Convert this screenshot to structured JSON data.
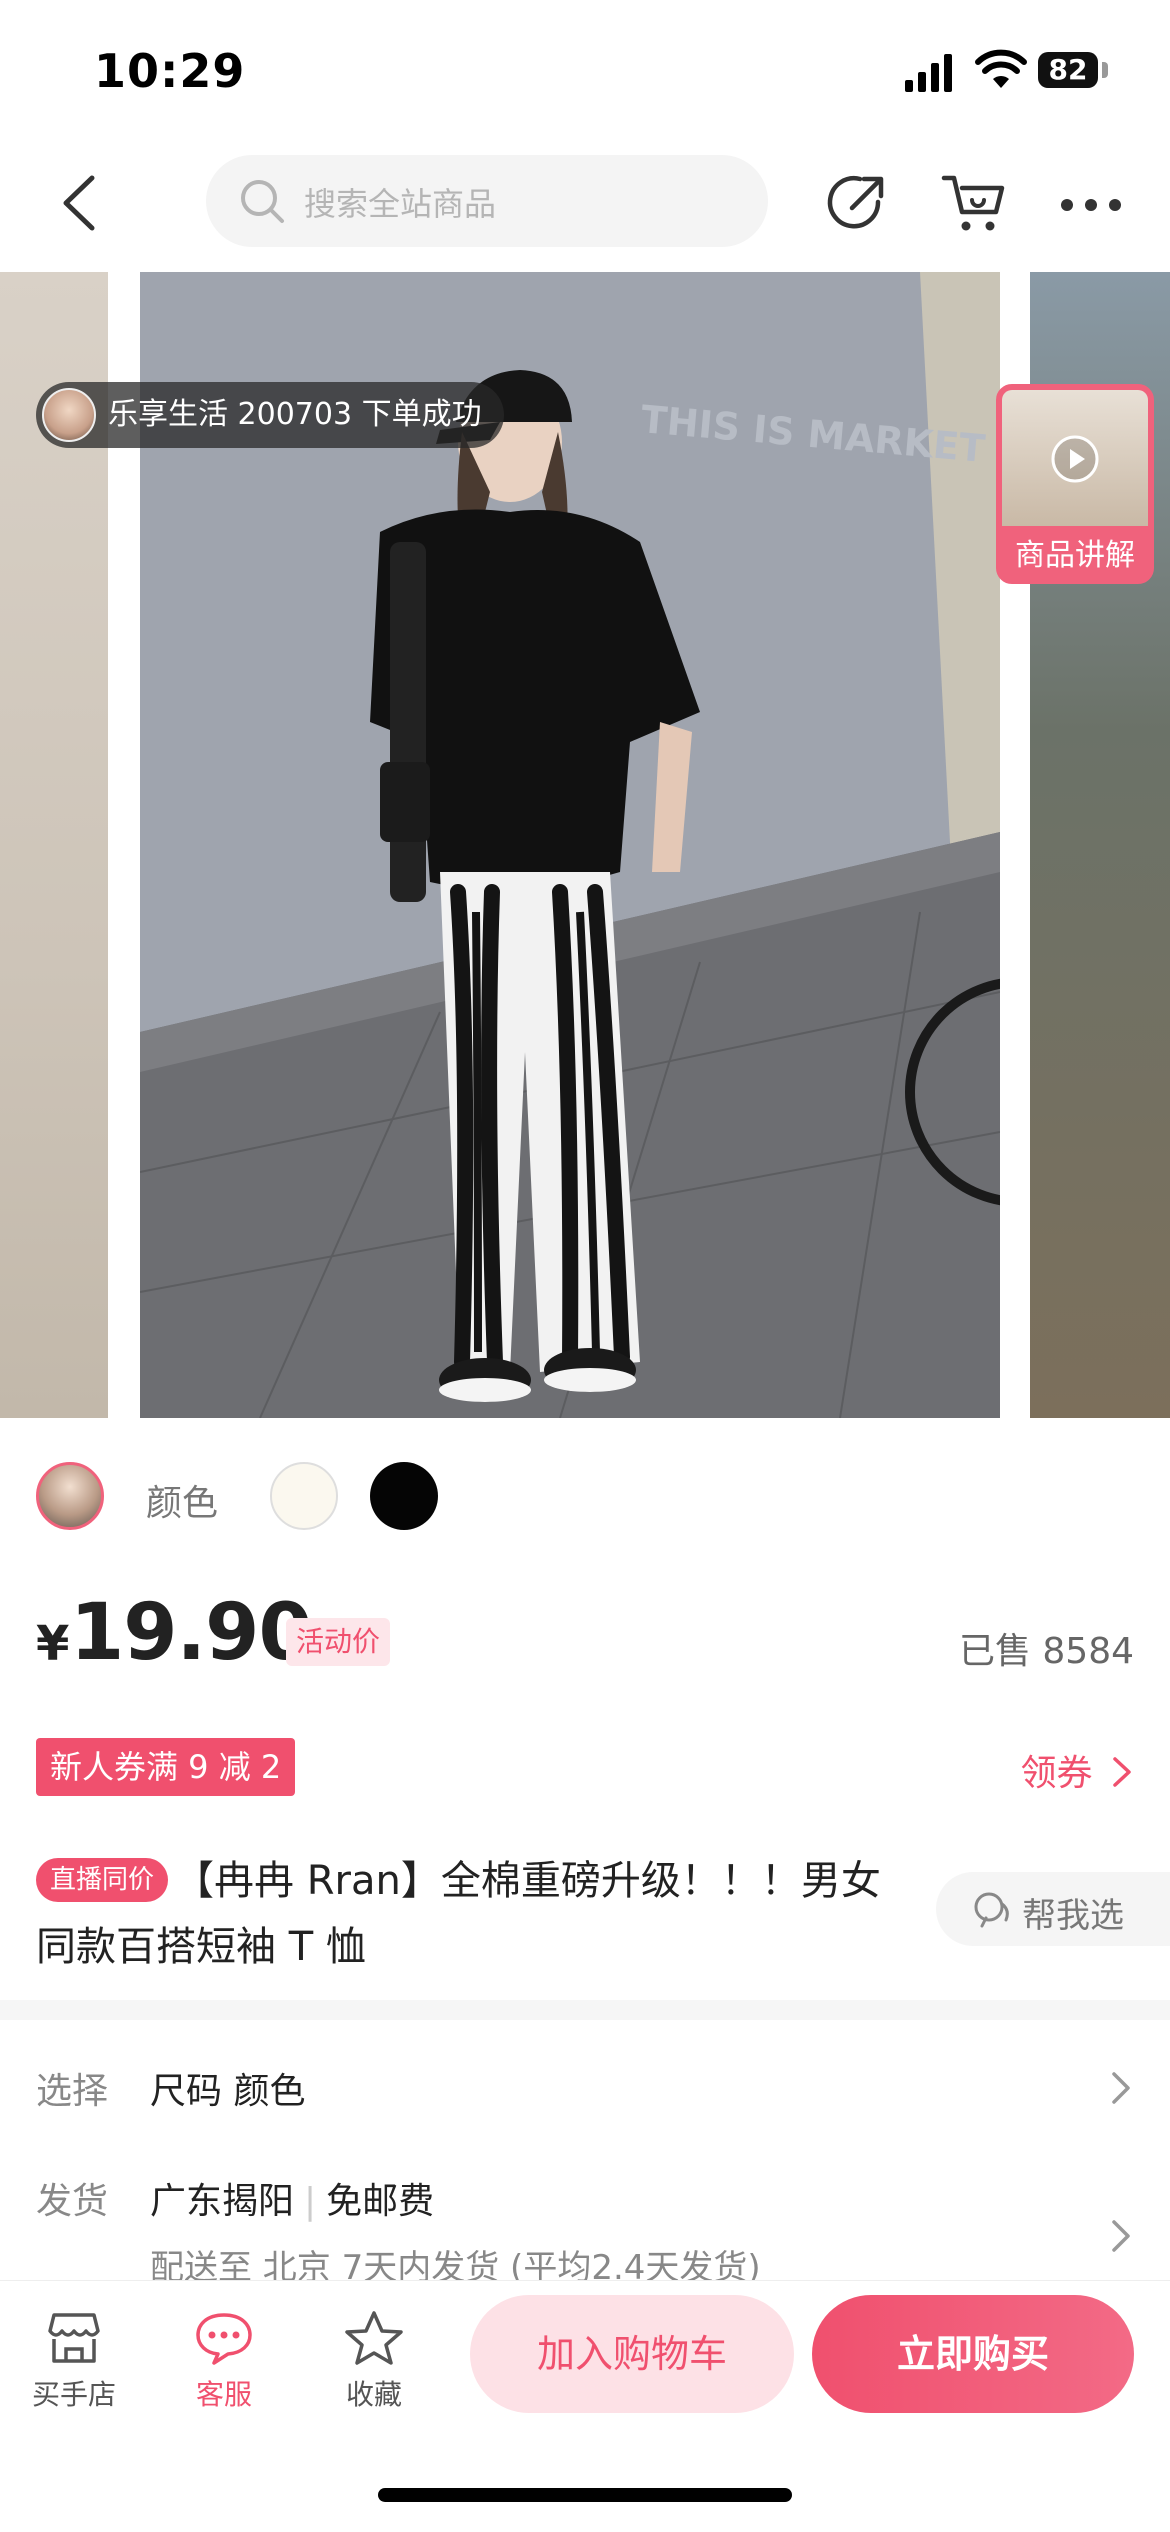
{
  "status_bar": {
    "time": "10:29",
    "battery": "82"
  },
  "nav": {
    "search_placeholder": "搜索全站商品"
  },
  "gallery": {
    "order_toast": "乐享生活 200703 下单成功",
    "video_label": "商品讲解",
    "wall_text": "THIS IS MARKET PROJECT"
  },
  "variants": {
    "color_label": "颜色",
    "swatches": [
      "#fbf8ef",
      "#050505"
    ]
  },
  "price": {
    "currency": "¥",
    "amount": "19.90",
    "promo_tag": "活动价",
    "sold": "已售 8584"
  },
  "coupon": {
    "tag": "新人券满 9 减 2",
    "link": "领券"
  },
  "product": {
    "live_tag": "直播同价",
    "title": "【冉冉 Rran】全棉重磅升级！！！男女同款百搭短袖 T 恤",
    "help_label": "帮我选"
  },
  "info": {
    "select_key": "选择",
    "select_val": "尺码 颜色",
    "ship_key": "发货",
    "ship_origin": "广东揭阳",
    "ship_fee": "免邮费",
    "ship_sub": "配送至 北京  7天内发货 (平均2.4天发货)"
  },
  "bottom_bar": {
    "store": "买手店",
    "service": "客服",
    "favorite": "收藏",
    "add_to_cart": "加入购物车",
    "buy_now": "立即购买"
  },
  "colors": {
    "accent": "#f0506e",
    "accent_light": "#fde1e6"
  }
}
